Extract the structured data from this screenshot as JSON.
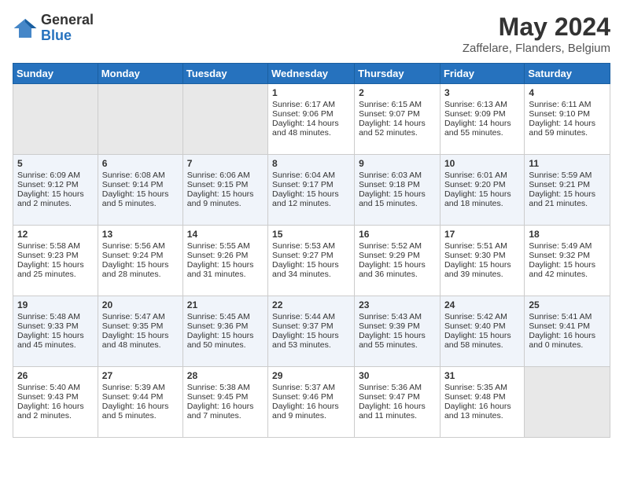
{
  "logo": {
    "general": "General",
    "blue": "Blue"
  },
  "title": {
    "month_year": "May 2024",
    "location": "Zaffelare, Flanders, Belgium"
  },
  "headers": [
    "Sunday",
    "Monday",
    "Tuesday",
    "Wednesday",
    "Thursday",
    "Friday",
    "Saturday"
  ],
  "weeks": [
    [
      {
        "day": "",
        "empty": true
      },
      {
        "day": "",
        "empty": true
      },
      {
        "day": "",
        "empty": true
      },
      {
        "day": "1",
        "sunrise": "Sunrise: 6:17 AM",
        "sunset": "Sunset: 9:06 PM",
        "daylight": "Daylight: 14 hours and 48 minutes."
      },
      {
        "day": "2",
        "sunrise": "Sunrise: 6:15 AM",
        "sunset": "Sunset: 9:07 PM",
        "daylight": "Daylight: 14 hours and 52 minutes."
      },
      {
        "day": "3",
        "sunrise": "Sunrise: 6:13 AM",
        "sunset": "Sunset: 9:09 PM",
        "daylight": "Daylight: 14 hours and 55 minutes."
      },
      {
        "day": "4",
        "sunrise": "Sunrise: 6:11 AM",
        "sunset": "Sunset: 9:10 PM",
        "daylight": "Daylight: 14 hours and 59 minutes."
      }
    ],
    [
      {
        "day": "5",
        "sunrise": "Sunrise: 6:09 AM",
        "sunset": "Sunset: 9:12 PM",
        "daylight": "Daylight: 15 hours and 2 minutes."
      },
      {
        "day": "6",
        "sunrise": "Sunrise: 6:08 AM",
        "sunset": "Sunset: 9:14 PM",
        "daylight": "Daylight: 15 hours and 5 minutes."
      },
      {
        "day": "7",
        "sunrise": "Sunrise: 6:06 AM",
        "sunset": "Sunset: 9:15 PM",
        "daylight": "Daylight: 15 hours and 9 minutes."
      },
      {
        "day": "8",
        "sunrise": "Sunrise: 6:04 AM",
        "sunset": "Sunset: 9:17 PM",
        "daylight": "Daylight: 15 hours and 12 minutes."
      },
      {
        "day": "9",
        "sunrise": "Sunrise: 6:03 AM",
        "sunset": "Sunset: 9:18 PM",
        "daylight": "Daylight: 15 hours and 15 minutes."
      },
      {
        "day": "10",
        "sunrise": "Sunrise: 6:01 AM",
        "sunset": "Sunset: 9:20 PM",
        "daylight": "Daylight: 15 hours and 18 minutes."
      },
      {
        "day": "11",
        "sunrise": "Sunrise: 5:59 AM",
        "sunset": "Sunset: 9:21 PM",
        "daylight": "Daylight: 15 hours and 21 minutes."
      }
    ],
    [
      {
        "day": "12",
        "sunrise": "Sunrise: 5:58 AM",
        "sunset": "Sunset: 9:23 PM",
        "daylight": "Daylight: 15 hours and 25 minutes."
      },
      {
        "day": "13",
        "sunrise": "Sunrise: 5:56 AM",
        "sunset": "Sunset: 9:24 PM",
        "daylight": "Daylight: 15 hours and 28 minutes."
      },
      {
        "day": "14",
        "sunrise": "Sunrise: 5:55 AM",
        "sunset": "Sunset: 9:26 PM",
        "daylight": "Daylight: 15 hours and 31 minutes."
      },
      {
        "day": "15",
        "sunrise": "Sunrise: 5:53 AM",
        "sunset": "Sunset: 9:27 PM",
        "daylight": "Daylight: 15 hours and 34 minutes."
      },
      {
        "day": "16",
        "sunrise": "Sunrise: 5:52 AM",
        "sunset": "Sunset: 9:29 PM",
        "daylight": "Daylight: 15 hours and 36 minutes."
      },
      {
        "day": "17",
        "sunrise": "Sunrise: 5:51 AM",
        "sunset": "Sunset: 9:30 PM",
        "daylight": "Daylight: 15 hours and 39 minutes."
      },
      {
        "day": "18",
        "sunrise": "Sunrise: 5:49 AM",
        "sunset": "Sunset: 9:32 PM",
        "daylight": "Daylight: 15 hours and 42 minutes."
      }
    ],
    [
      {
        "day": "19",
        "sunrise": "Sunrise: 5:48 AM",
        "sunset": "Sunset: 9:33 PM",
        "daylight": "Daylight: 15 hours and 45 minutes."
      },
      {
        "day": "20",
        "sunrise": "Sunrise: 5:47 AM",
        "sunset": "Sunset: 9:35 PM",
        "daylight": "Daylight: 15 hours and 48 minutes."
      },
      {
        "day": "21",
        "sunrise": "Sunrise: 5:45 AM",
        "sunset": "Sunset: 9:36 PM",
        "daylight": "Daylight: 15 hours and 50 minutes."
      },
      {
        "day": "22",
        "sunrise": "Sunrise: 5:44 AM",
        "sunset": "Sunset: 9:37 PM",
        "daylight": "Daylight: 15 hours and 53 minutes."
      },
      {
        "day": "23",
        "sunrise": "Sunrise: 5:43 AM",
        "sunset": "Sunset: 9:39 PM",
        "daylight": "Daylight: 15 hours and 55 minutes."
      },
      {
        "day": "24",
        "sunrise": "Sunrise: 5:42 AM",
        "sunset": "Sunset: 9:40 PM",
        "daylight": "Daylight: 15 hours and 58 minutes."
      },
      {
        "day": "25",
        "sunrise": "Sunrise: 5:41 AM",
        "sunset": "Sunset: 9:41 PM",
        "daylight": "Daylight: 16 hours and 0 minutes."
      }
    ],
    [
      {
        "day": "26",
        "sunrise": "Sunrise: 5:40 AM",
        "sunset": "Sunset: 9:43 PM",
        "daylight": "Daylight: 16 hours and 2 minutes."
      },
      {
        "day": "27",
        "sunrise": "Sunrise: 5:39 AM",
        "sunset": "Sunset: 9:44 PM",
        "daylight": "Daylight: 16 hours and 5 minutes."
      },
      {
        "day": "28",
        "sunrise": "Sunrise: 5:38 AM",
        "sunset": "Sunset: 9:45 PM",
        "daylight": "Daylight: 16 hours and 7 minutes."
      },
      {
        "day": "29",
        "sunrise": "Sunrise: 5:37 AM",
        "sunset": "Sunset: 9:46 PM",
        "daylight": "Daylight: 16 hours and 9 minutes."
      },
      {
        "day": "30",
        "sunrise": "Sunrise: 5:36 AM",
        "sunset": "Sunset: 9:47 PM",
        "daylight": "Daylight: 16 hours and 11 minutes."
      },
      {
        "day": "31",
        "sunrise": "Sunrise: 5:35 AM",
        "sunset": "Sunset: 9:48 PM",
        "daylight": "Daylight: 16 hours and 13 minutes."
      },
      {
        "day": "",
        "empty": true
      }
    ]
  ]
}
